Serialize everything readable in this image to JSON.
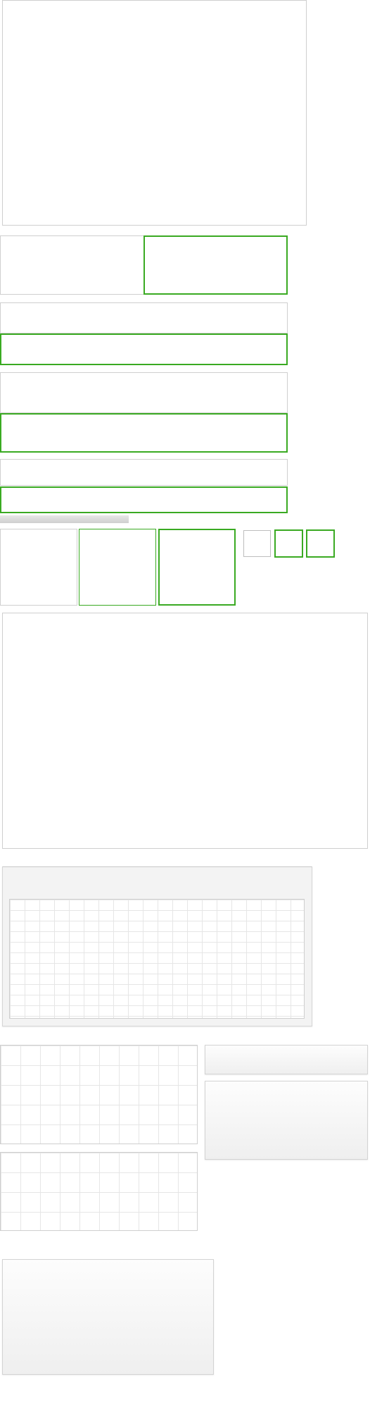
{
  "screen": {
    "title": ""
  },
  "colors": {
    "accent": "#3aaa22",
    "border": "#cfcfcf",
    "panel_bg": "#ffffff",
    "muted_bg": "#f3f3f3"
  }
}
